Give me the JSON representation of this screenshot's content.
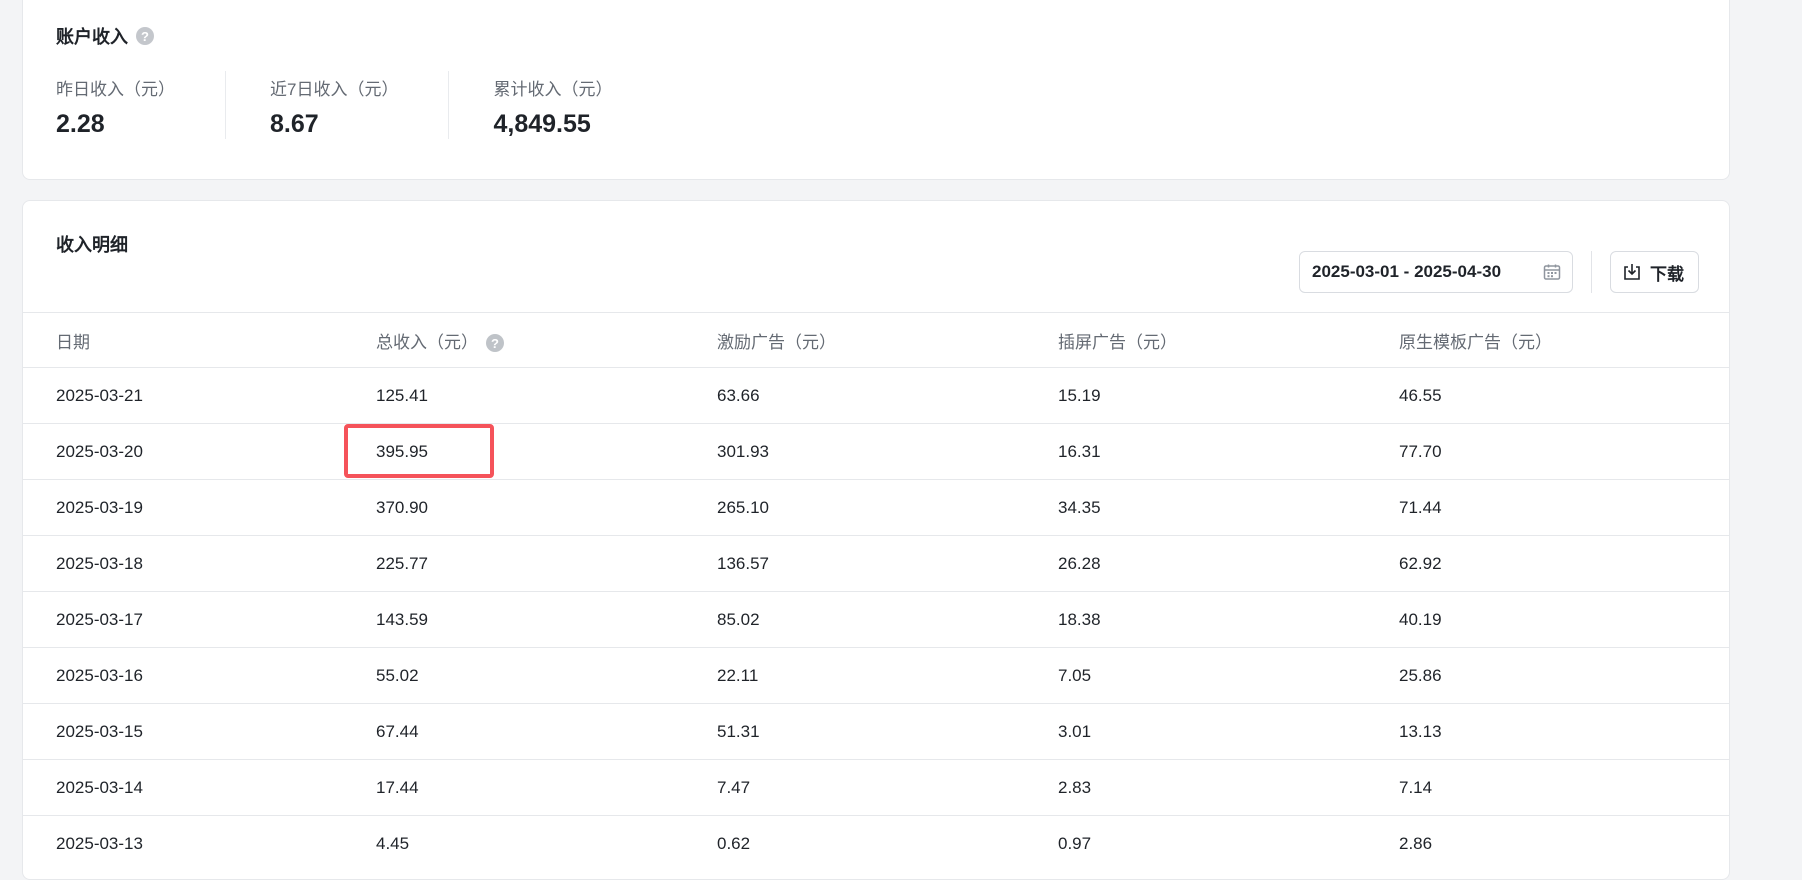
{
  "summary": {
    "title": "账户收入",
    "help_icon": "?",
    "stats": [
      {
        "label": "昨日收入（元）",
        "value": "2.28"
      },
      {
        "label": "近7日收入（元）",
        "value": "8.67"
      },
      {
        "label": "累计收入（元）",
        "value": "4,849.55"
      }
    ]
  },
  "detail": {
    "title": "收入明细",
    "date_range": "2025-03-01 - 2025-04-30",
    "download_label": "下载",
    "columns": [
      "日期",
      "总收入（元）",
      "激励广告（元）",
      "插屏广告（元）",
      "原生模板广告（元）"
    ],
    "column_help_icon": "?",
    "rows": [
      [
        "2025-03-21",
        "125.41",
        "63.66",
        "15.19",
        "46.55"
      ],
      [
        "2025-03-20",
        "395.95",
        "301.93",
        "16.31",
        "77.70"
      ],
      [
        "2025-03-19",
        "370.90",
        "265.10",
        "34.35",
        "71.44"
      ],
      [
        "2025-03-18",
        "225.77",
        "136.57",
        "26.28",
        "62.92"
      ],
      [
        "2025-03-17",
        "143.59",
        "85.02",
        "18.38",
        "40.19"
      ],
      [
        "2025-03-16",
        "55.02",
        "22.11",
        "7.05",
        "25.86"
      ],
      [
        "2025-03-15",
        "67.44",
        "51.31",
        "3.01",
        "13.13"
      ],
      [
        "2025-03-14",
        "17.44",
        "7.47",
        "2.83",
        "7.14"
      ],
      [
        "2025-03-13",
        "4.45",
        "0.62",
        "0.97",
        "2.86"
      ]
    ]
  },
  "colors": {
    "highlight": "#f5535a",
    "border": "#e6e8eb",
    "muted_text": "#646a73"
  }
}
